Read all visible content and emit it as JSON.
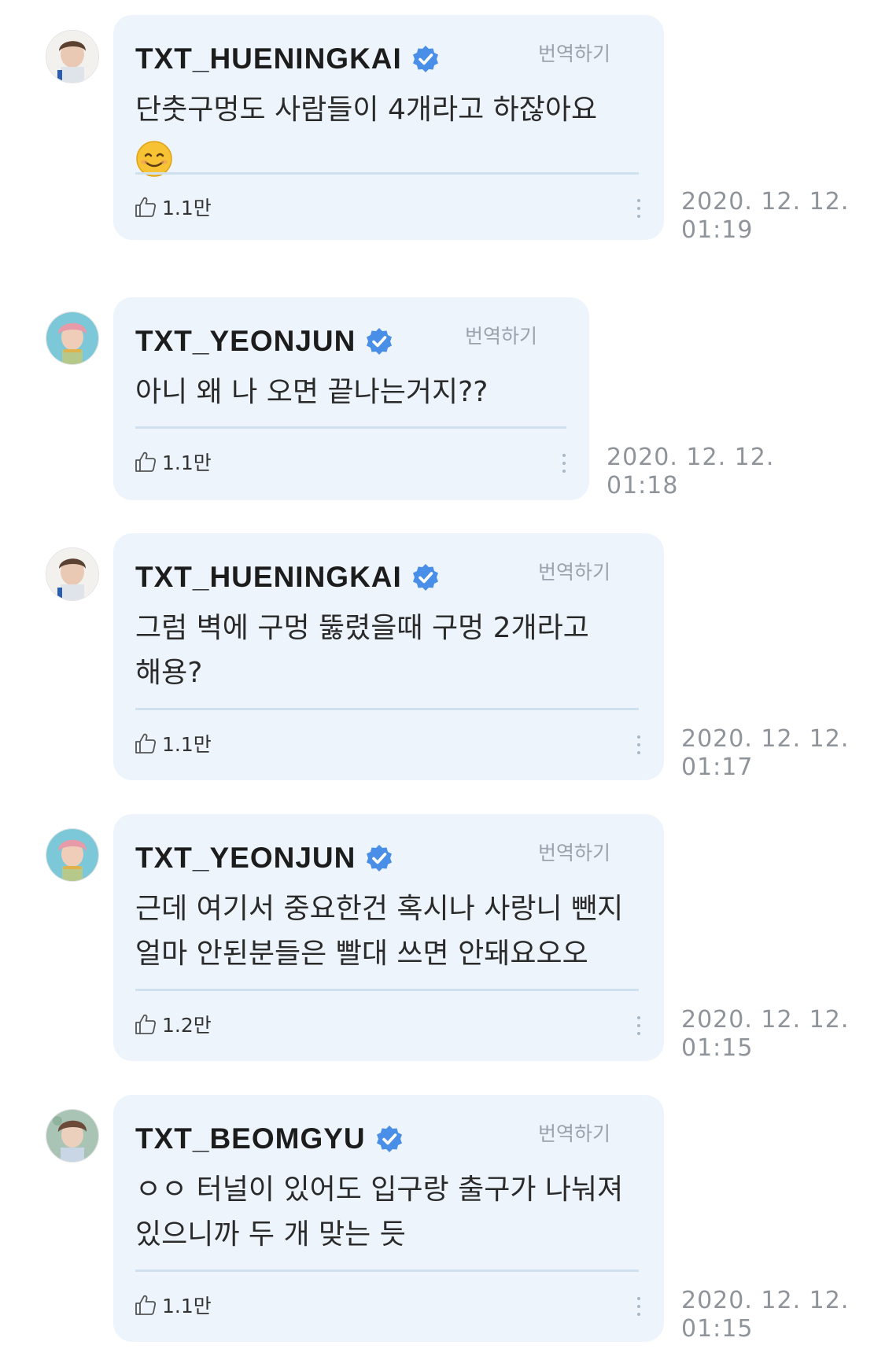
{
  "comments": [
    {
      "username": "TXT_HUENINGKAI",
      "translate_label": "번역하기",
      "text": "단춧구멍도 사람들이 4개라고 하잖아요",
      "emoji": "smiling-face",
      "likes": "1.1만",
      "date": "2020. 12. 12.",
      "time": "01:19"
    },
    {
      "username": "TXT_YEONJUN",
      "translate_label": "번역하기",
      "text": "아니 왜 나 오면 끝나는거지??",
      "likes": "1.1만",
      "date": "2020. 12. 12.",
      "time": "01:18"
    },
    {
      "username": "TXT_HUENINGKAI",
      "translate_label": "번역하기",
      "text": "그럼 벽에 구멍 뚫렸을때 구멍 2개라고 해용?",
      "likes": "1.1만",
      "date": "2020. 12. 12.",
      "time": "01:17"
    },
    {
      "username": "TXT_YEONJUN",
      "translate_label": "번역하기",
      "text": "근데 여기서 중요한건 혹시나 사랑니 뺀지 얼마 안된분들은 빨대 쓰면 안돼요오오",
      "likes": "1.2만",
      "date": "2020. 12. 12.",
      "time": "01:15"
    },
    {
      "username": "TXT_BEOMGYU",
      "translate_label": "번역하기",
      "text": "ㅇㅇ 터널이 있어도 입구랑 출구가 나눠져 있으니까 두 개 맞는 듯",
      "likes": "1.1만",
      "date": "2020. 12. 12.",
      "time": "01:15"
    }
  ],
  "colors": {
    "bubble": "#edf4fb",
    "verified": "#4a8fe7",
    "divider": "#cfe1ee"
  }
}
